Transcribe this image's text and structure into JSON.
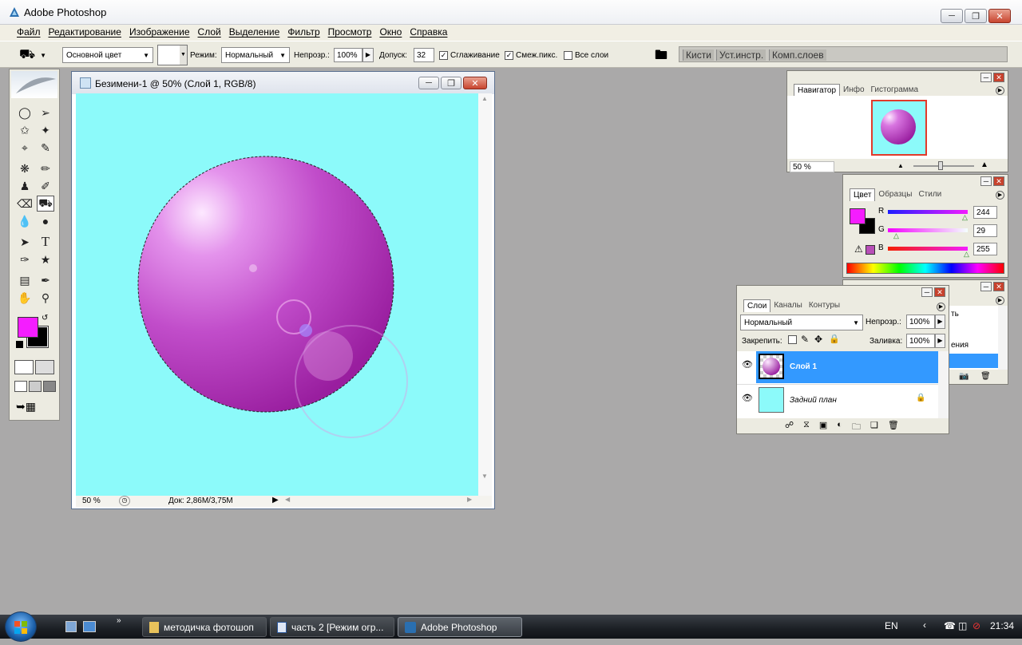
{
  "app": {
    "title": "Adobe Photoshop"
  },
  "menu": [
    "Файл",
    "Редактирование",
    "Изображение",
    "Слой",
    "Выделение",
    "Фильтр",
    "Просмотр",
    "Окно",
    "Справка"
  ],
  "options": {
    "fill_source": "Основной цвет",
    "mode_label": "Режим:",
    "mode_value": "Нормальный",
    "opacity_label": "Непрозр.:",
    "opacity_value": "100%",
    "tolerance_label": "Допуск:",
    "tolerance_value": "32",
    "antialias_label": "Сглаживание",
    "contiguous_label": "Смеж.пикс.",
    "all_layers_label": "Все слои"
  },
  "palette_well": [
    "Кисти",
    "Уст.инстр.",
    "Комп.слоев"
  ],
  "document": {
    "title": "Безимени-1 @ 50% (Слой 1, RGB/8)",
    "zoom": "50 %",
    "doc_size": "Док: 2,86М/3,75М",
    "canvas_color": "#8cfafa"
  },
  "navigator": {
    "tabs": [
      "Навигатор",
      "Инфо",
      "Гистограмма"
    ],
    "zoom": "50 %"
  },
  "color_panel": {
    "tabs": [
      "Цвет",
      "Образцы",
      "Стили"
    ],
    "foreground": "#f41dff",
    "r_label": "R",
    "r_value": "244",
    "g_label": "G",
    "g_value": "29",
    "b_label": "B",
    "b_value": "255"
  },
  "history_panel": {
    "partial_texts": [
      "ть",
      "ения"
    ]
  },
  "layers": {
    "tabs": [
      "Слои",
      "Каналы",
      "Контуры"
    ],
    "blend_mode": "Нормальный",
    "opacity_label": "Непрозр.:",
    "opacity_value": "100%",
    "lock_label": "Закрепить:",
    "fill_label": "Заливка:",
    "fill_value": "100%",
    "items": [
      {
        "name": "Слой 1",
        "selected": true
      },
      {
        "name": "Задний план",
        "selected": false
      }
    ]
  },
  "taskbar": {
    "items": [
      "методичка фотошоп",
      "часть 2 [Режим огр...",
      "Adobe Photoshop"
    ],
    "lang": "EN",
    "time": "21:34"
  },
  "colors": {
    "selection": "#3399ff",
    "sphere": "#b02fb8"
  }
}
